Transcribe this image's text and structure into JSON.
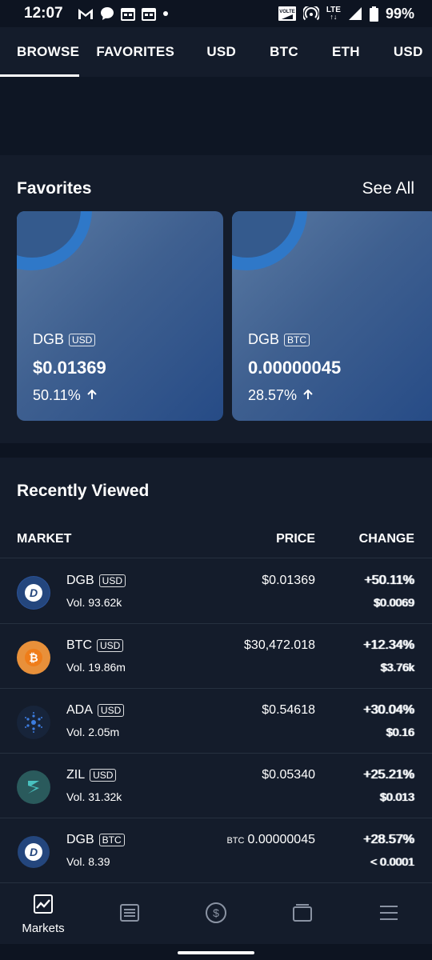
{
  "status_bar": {
    "time": "12:07",
    "volte_label": "VOLTE",
    "network": "LTE",
    "battery": "99%"
  },
  "tabs": [
    "BROWSE",
    "FAVORITES",
    "USD",
    "BTC",
    "ETH",
    "USD"
  ],
  "favorites": {
    "title": "Favorites",
    "see_all": "See All",
    "cards": [
      {
        "symbol": "DGB",
        "quote": "USD",
        "price": "$0.01369",
        "change": "50.11%"
      },
      {
        "symbol": "DGB",
        "quote": "BTC",
        "price": "0.00000045",
        "change": "28.57%"
      }
    ]
  },
  "recent": {
    "title": "Recently Viewed",
    "col_market": "MARKET",
    "col_price": "PRICE",
    "col_change": "CHANGE",
    "rows": [
      {
        "symbol": "DGB",
        "quote": "USD",
        "volume": "Vol. 93.62k",
        "price_prefix": "",
        "price": "$0.01369",
        "change": "+50.11%",
        "change_abs": "$0.0069",
        "icon": "digibyte-icon",
        "color": "#2a5298"
      },
      {
        "symbol": "BTC",
        "quote": "USD",
        "volume": "Vol. 19.86m",
        "price_prefix": "",
        "price": "$30,472.018",
        "change": "+12.34%",
        "change_abs": "$3.76k",
        "icon": "bitcoin-icon",
        "color": "#e8903a"
      },
      {
        "symbol": "ADA",
        "quote": "USD",
        "volume": "Vol. 2.05m",
        "price_prefix": "",
        "price": "$0.54618",
        "change": "+30.04%",
        "change_abs": "$0.16",
        "icon": "cardano-icon",
        "color": "#17243a"
      },
      {
        "symbol": "ZIL",
        "quote": "USD",
        "volume": "Vol. 31.32k",
        "price_prefix": "",
        "price": "$0.05340",
        "change": "+25.21%",
        "change_abs": "$0.013",
        "icon": "zilliqa-icon",
        "color": "#2a5a5c"
      },
      {
        "symbol": "DGB",
        "quote": "BTC",
        "volume": "Vol. 8.39",
        "price_prefix": "BTC",
        "price": "0.00000045",
        "change": "+28.57%",
        "change_abs": "< 0.0001",
        "icon": "digibyte-icon",
        "color": "#2a5298"
      }
    ]
  },
  "bottom_nav": {
    "markets_label": "Markets"
  }
}
